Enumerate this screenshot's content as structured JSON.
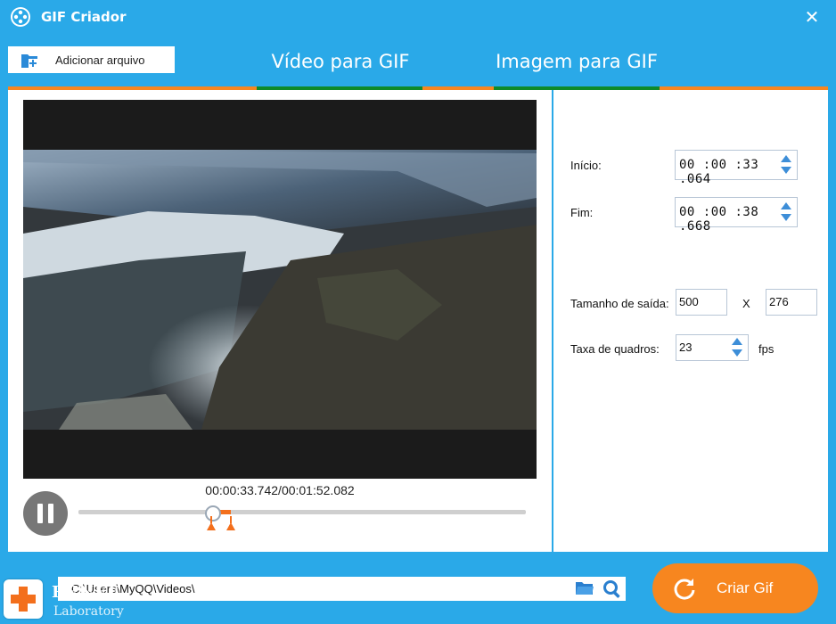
{
  "window": {
    "title": "GIF Criador",
    "close_symbol": "✕"
  },
  "toolbar": {
    "add_file_label": "Adicionar arquivo"
  },
  "tabs": [
    {
      "label": "Vídeo para GIF",
      "active": true
    },
    {
      "label": "Imagem para GIF",
      "active": false
    }
  ],
  "player": {
    "current_time": "00:00:33.742",
    "separator": "/",
    "total_time": "00:01:52.082",
    "playhead_fraction": 0.301,
    "selection_start_fraction": 0.296,
    "selection_end_fraction": 0.34
  },
  "settings": {
    "start_label": "Início:",
    "start_value": "00 :00 :33 .064",
    "end_label": "Fim:",
    "end_value": "00 :00 :38 .668",
    "output_size_label": "Tamanho de saída:",
    "width_value": "500",
    "size_separator": "X",
    "height_value": "276",
    "frame_rate_label": "Taxa de quadros:",
    "frame_rate_value": "23",
    "frame_rate_unit": "fps"
  },
  "output": {
    "path": "C:\\Users\\MyQQ\\Videos\\",
    "folder_icon": "folder-icon",
    "search_icon": "search-icon"
  },
  "create_button": {
    "label": "Criar Gif",
    "icon": "refresh-icon"
  },
  "logo": {
    "name": "RENEE",
    "sub": "Laboratory"
  },
  "colors": {
    "frame": "#2aa9e8",
    "accent_orange": "#f7861f",
    "tab_active_green": "#0e8a2a",
    "spinner_blue": "#3d8ed8"
  }
}
